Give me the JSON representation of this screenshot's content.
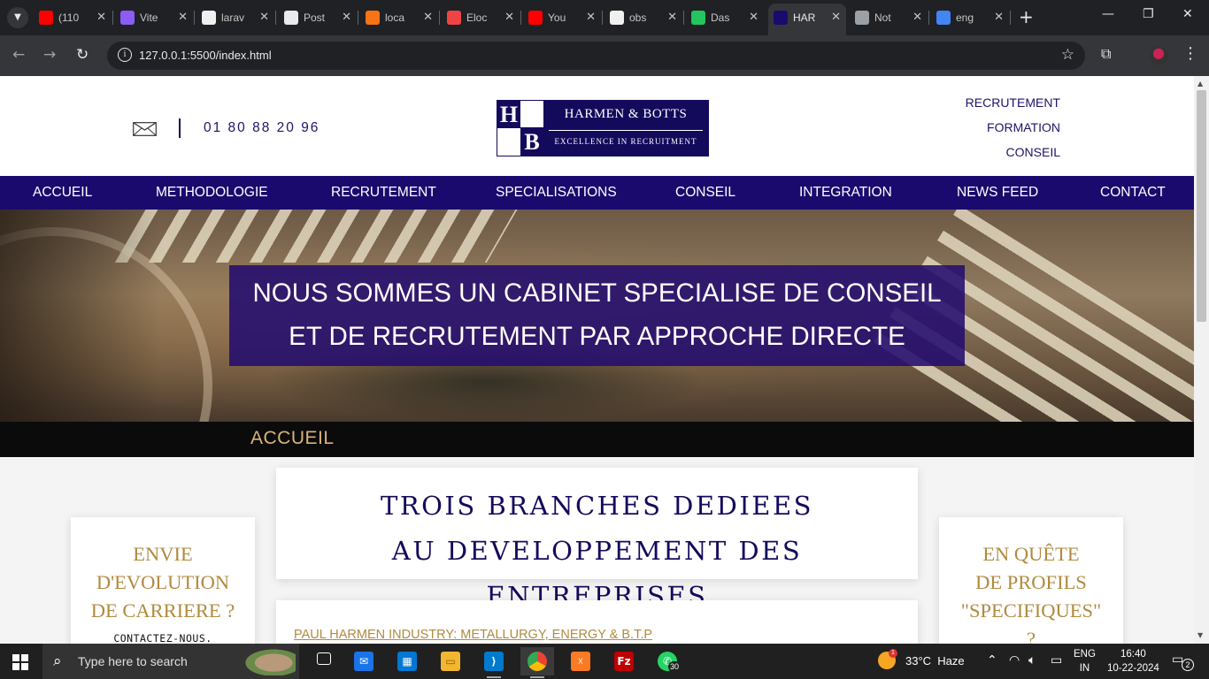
{
  "browser": {
    "tabs": [
      {
        "title": "(110",
        "favicon": "youtube-icon",
        "color": "#ff0000"
      },
      {
        "title": "Vite",
        "favicon": "vite-icon",
        "color": "#8b5cf6"
      },
      {
        "title": "larav",
        "favicon": "github-icon",
        "color": "#f0f0f0"
      },
      {
        "title": "Post",
        "favicon": "openai-icon",
        "color": "#e8eaed"
      },
      {
        "title": "loca",
        "favicon": "xampp-icon",
        "color": "#f97316"
      },
      {
        "title": "Eloc",
        "favicon": "laravel-icon",
        "color": "#ef4444"
      },
      {
        "title": "You",
        "favicon": "youtube-icon",
        "color": "#ff0000"
      },
      {
        "title": "obs",
        "favicon": "github-icon",
        "color": "#f0f0f0"
      },
      {
        "title": "Das",
        "favicon": "dashboard-icon",
        "color": "#22c55e"
      },
      {
        "title": "HAR",
        "favicon": "hb-logo-icon",
        "color": "#1a0a6e"
      },
      {
        "title": "Not",
        "favicon": "globe-icon",
        "color": "#9aa0a6"
      },
      {
        "title": "eng",
        "favicon": "google-icon",
        "color": "#4285f4"
      }
    ],
    "url": "127.0.0.1:5500/index.html"
  },
  "site": {
    "phone": "01 80 88 20 96",
    "logo": {
      "h": "H",
      "b": "B",
      "name": "HARMEN & BOTTS",
      "tagline": "EXCELLENCE IN RECRUITMENT"
    },
    "service_links": [
      "RECRUTEMENT",
      "FORMATION",
      "CONSEIL"
    ],
    "nav": [
      "ACCUEIL",
      "METHODOLOGIE",
      "RECRUTEMENT",
      "SPECIALISATIONS",
      "CONSEIL",
      "INTEGRATION",
      "NEWS FEED",
      "CONTACT"
    ],
    "hero": {
      "line1": "NOUS SOMMES UN CABINET SPECIALISE DE CONSEIL",
      "line2": "ET DE RECRUTEMENT PAR APPROCHE DIRECTE"
    },
    "breadcrumb": "ACCUEIL",
    "left_card": {
      "title_lines": [
        "ENVIE",
        "D'EVOLUTION",
        "DE CARRIERE ?"
      ],
      "cta": "CONTACTEZ-NOUS."
    },
    "center_card": {
      "line1": "TROIS BRANCHES DEDIEES",
      "line2": "AU DEVELOPPEMENT DES ENTREPRISES"
    },
    "branch_link": "PAUL HARMEN INDUSTRY: METALLURGY, ENERGY & B.T.P",
    "right_card": {
      "title_lines": [
        "EN QUÊTE",
        "DE PROFILS",
        "\"SPECIFIQUES\"",
        "?"
      ]
    },
    "colors": {
      "navy": "#1a0a6e",
      "gold": "#b08a3e",
      "breadcrumb_gold": "#d9b37a"
    }
  },
  "taskbar": {
    "search_placeholder": "Type here to search",
    "whatsapp_badge": "30",
    "weather": "33°C  Haze",
    "weather_alert": "1",
    "lang_line1": "ENG",
    "lang_line2": "IN",
    "time": "16:40",
    "date": "10-22-2024",
    "notifications": "2"
  }
}
